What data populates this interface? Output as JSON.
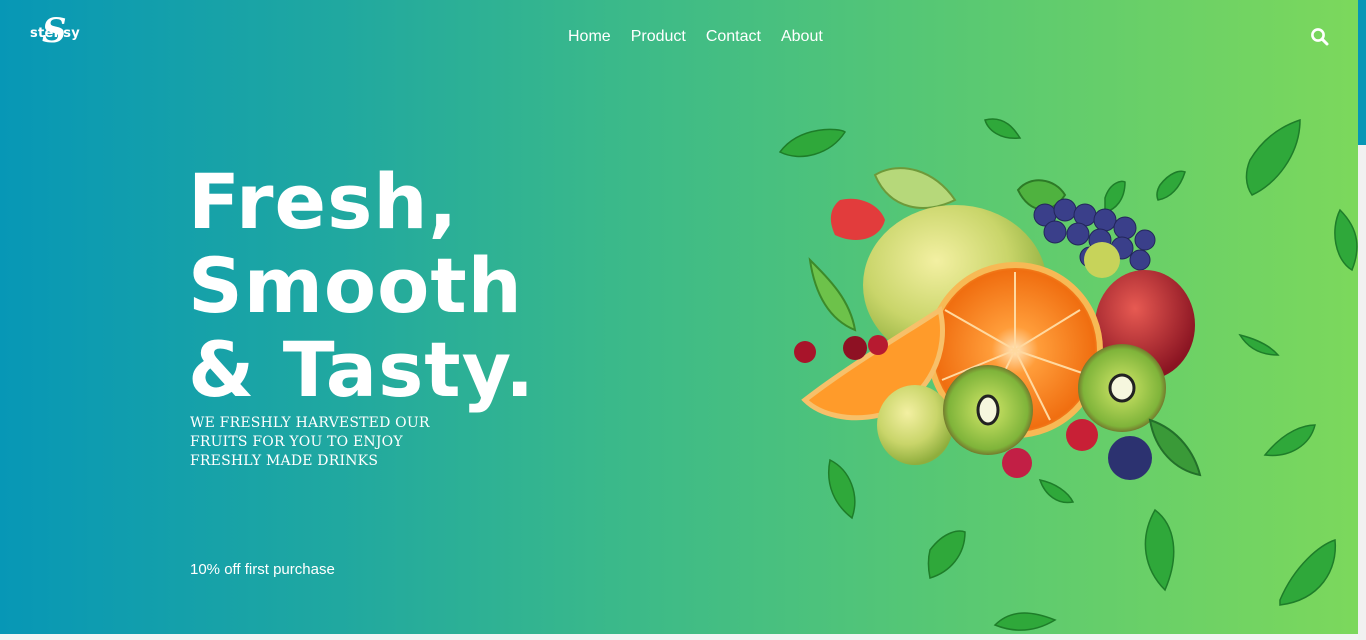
{
  "brand": {
    "logo_letter": "S",
    "logo_text": "stensy"
  },
  "nav": {
    "items": [
      "Home",
      "Product",
      "Contact",
      "About"
    ]
  },
  "header": {
    "search_icon": "search-icon"
  },
  "hero": {
    "headline_lines": [
      "Fresh,",
      "Smooth",
      "& Tasty."
    ],
    "subheading": "We freshly harvested our fruits for you to enjoy freshly made drinks",
    "promo": "10% off first purchase"
  },
  "colors": {
    "gradient_start": "#0797b6",
    "gradient_end": "#7cd85c",
    "text": "#ffffff",
    "leaf": "#2fa83a",
    "orange": "#f47a16",
    "kiwi": "#7fb43a"
  }
}
